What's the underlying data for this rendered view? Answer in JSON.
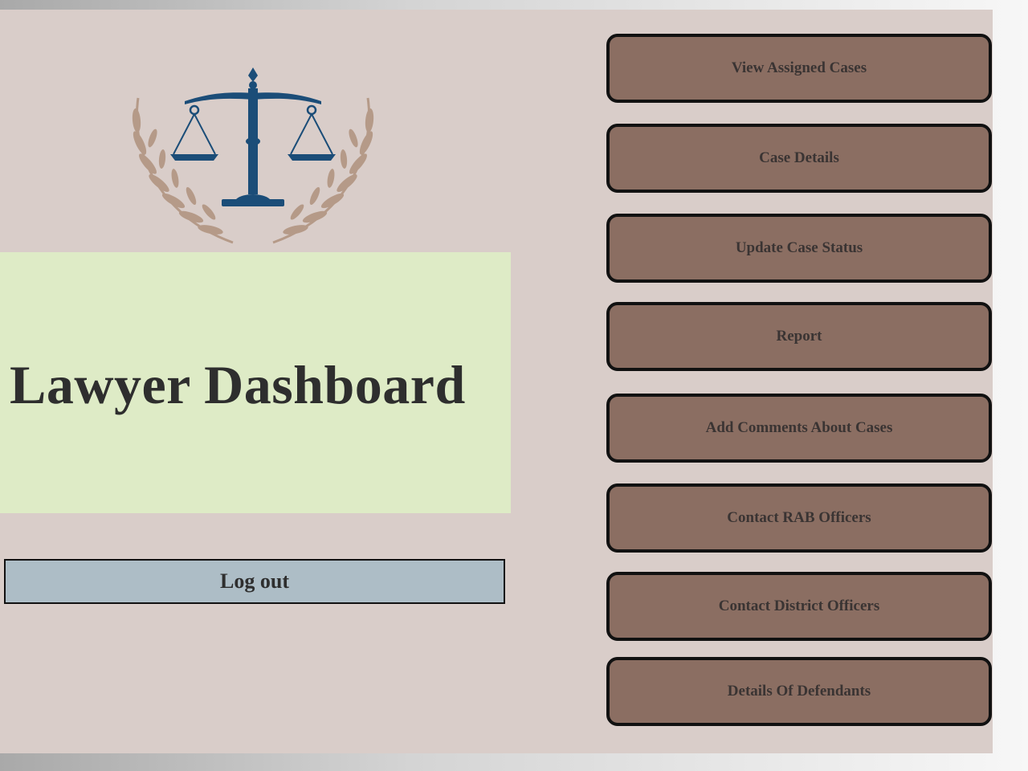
{
  "header": {
    "title": "Lawyer Dashboard"
  },
  "logout": {
    "label": "Log out"
  },
  "menu": {
    "items": [
      {
        "label": "View Assigned Cases"
      },
      {
        "label": "Case Details"
      },
      {
        "label": "Update Case Status"
      },
      {
        "label": "Report"
      },
      {
        "label": "Add Comments About Cases"
      },
      {
        "label": "Contact RAB Officers"
      },
      {
        "label": "Contact District Officers"
      },
      {
        "label": "Details Of Defendants"
      }
    ]
  },
  "colors": {
    "panel_background": "#d9cdc9",
    "title_box_background": "#deebc6",
    "menu_button_background": "#8b6e62",
    "logout_button_background": "#adbdc6",
    "logo_scale_color": "#1b4d78",
    "logo_laurel_color": "#b59a88",
    "text_color": "#2e2e2e"
  },
  "icons": {
    "logo": "scales-of-justice-with-laurel-icon"
  }
}
